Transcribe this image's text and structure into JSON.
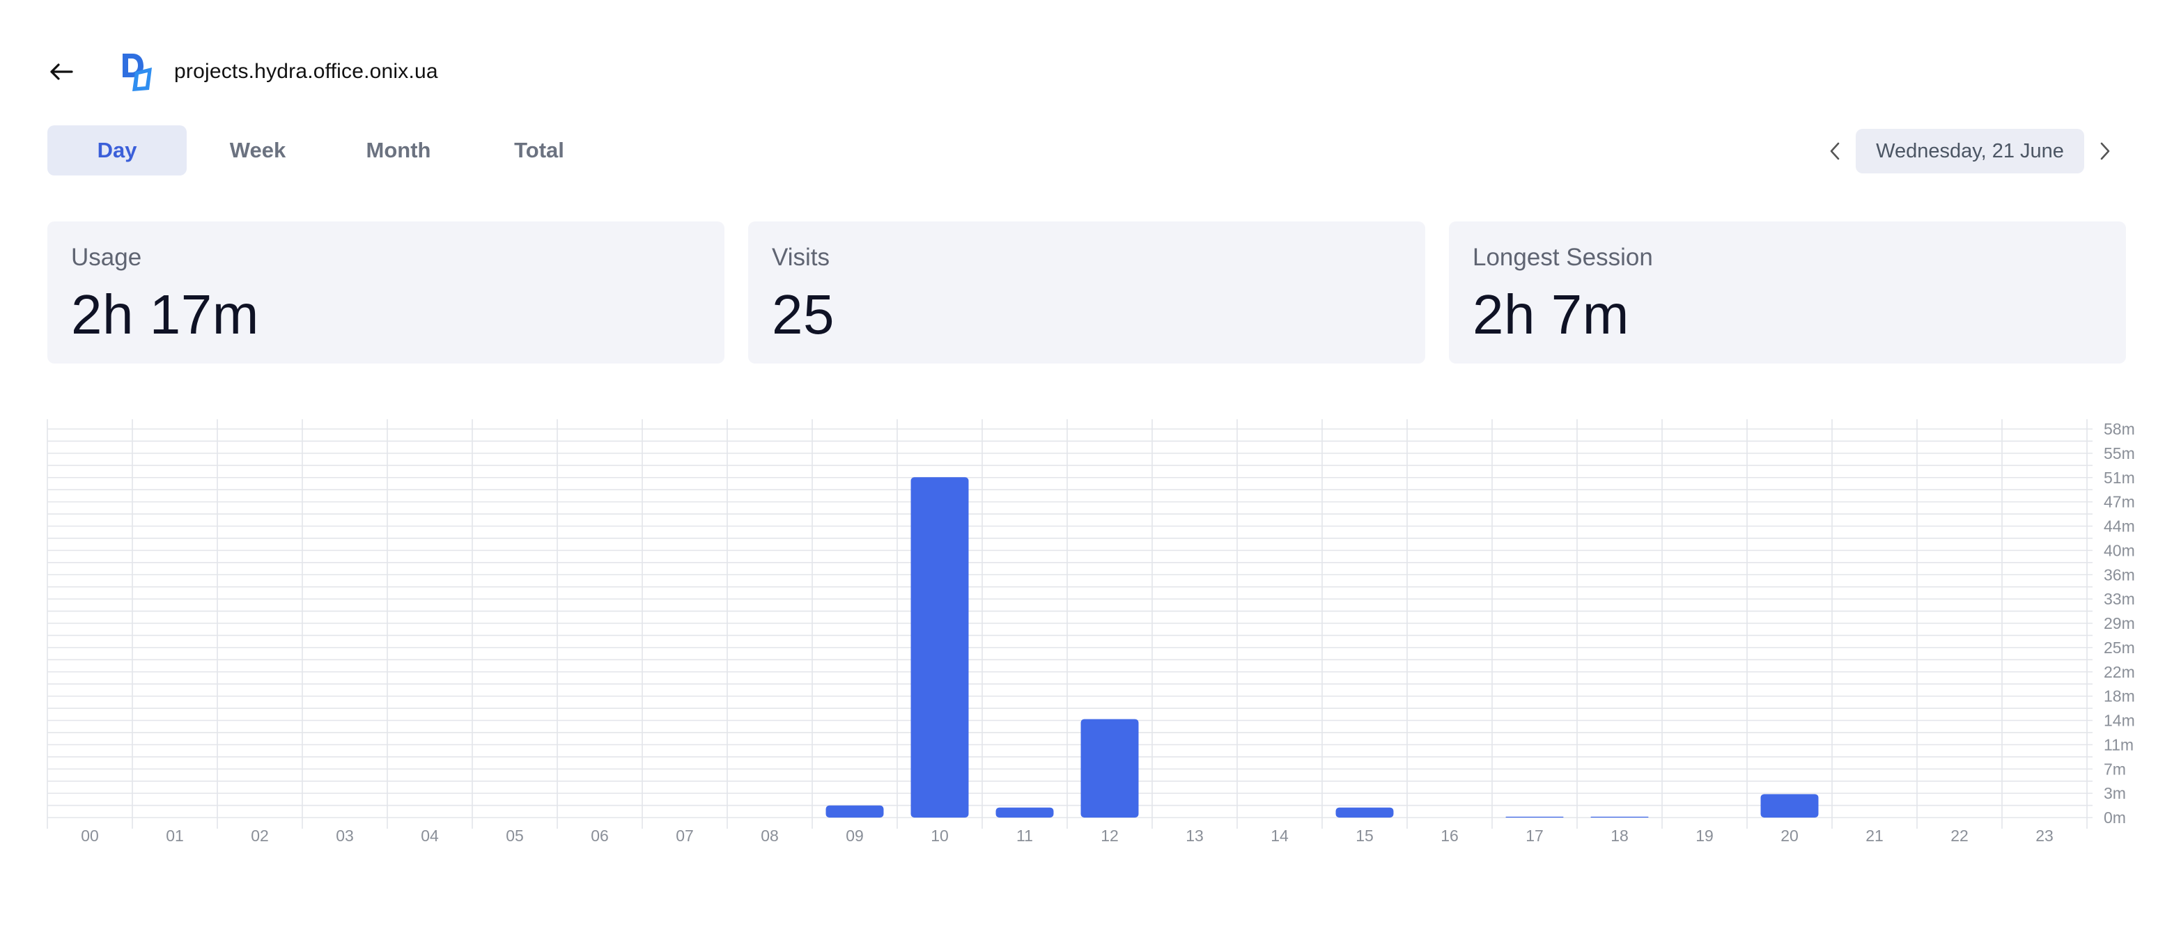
{
  "header": {
    "back_icon": "arrow-left-icon",
    "logo_icon": "site-logo-icon",
    "title": "projects.hydra.office.onix.ua"
  },
  "tabs": [
    {
      "label": "Day",
      "active": true
    },
    {
      "label": "Week",
      "active": false
    },
    {
      "label": "Month",
      "active": false
    },
    {
      "label": "Total",
      "active": false
    }
  ],
  "date_nav": {
    "prev_icon": "chevron-left-icon",
    "date": "Wednesday, 21 June",
    "next_icon": "chevron-right-icon"
  },
  "stats": {
    "usage": {
      "label": "Usage",
      "value": "2h 17m"
    },
    "visits": {
      "label": "Visits",
      "value": "25"
    },
    "longest": {
      "label": "Longest Session",
      "value": "2h 7m"
    }
  },
  "colors": {
    "accent": "#4169e8",
    "active_tab_bg": "#e6eaf6",
    "active_tab_text": "#3b5fd9",
    "card_bg": "#f3f4f9",
    "grid": "#e3e5ea",
    "tick_text": "#8a8f98"
  },
  "chart_data": {
    "type": "bar",
    "categories": [
      "00",
      "01",
      "02",
      "03",
      "04",
      "05",
      "06",
      "07",
      "08",
      "09",
      "10",
      "11",
      "12",
      "13",
      "14",
      "15",
      "16",
      "17",
      "18",
      "19",
      "20",
      "21",
      "22",
      "23"
    ],
    "values": [
      0,
      0,
      0,
      0,
      0,
      0,
      0,
      0,
      0,
      1.8,
      50.8,
      1.5,
      14.7,
      0,
      0,
      1.5,
      0,
      0.1,
      0.1,
      0,
      3.5,
      0,
      0,
      0
    ],
    "value_unit": "minutes",
    "y_ticks": [
      "0m",
      "3m",
      "7m",
      "11m",
      "14m",
      "18m",
      "22m",
      "25m",
      "29m",
      "33m",
      "36m",
      "40m",
      "44m",
      "47m",
      "51m",
      "55m",
      "58m"
    ],
    "ylim": [
      0,
      58
    ],
    "grid": true,
    "y_axis_position": "right",
    "title": "",
    "xlabel": "",
    "ylabel": ""
  }
}
